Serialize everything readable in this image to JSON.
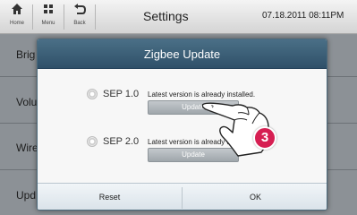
{
  "topbar": {
    "nav": [
      {
        "icon": "home-icon",
        "label": "Home"
      },
      {
        "icon": "menu-icon",
        "label": "Menu"
      },
      {
        "icon": "back-icon",
        "label": "Back"
      }
    ],
    "title": "Settings",
    "datetime": "07.18.2011 08:11PM"
  },
  "list": {
    "items": [
      "Brig",
      "Volu",
      "Wire",
      "Upd"
    ]
  },
  "dialog": {
    "title": "Zigbee Update",
    "options": [
      {
        "label": "SEP 1.0",
        "status": "Latest version is already installed.",
        "button": "Update"
      },
      {
        "label": "SEP 2.0",
        "status": "Latest version is already ins",
        "button": "Update"
      }
    ],
    "footer": {
      "reset": "Reset",
      "ok": "OK"
    }
  },
  "annotation": {
    "step": "3",
    "badge_color": "#d61f52"
  },
  "colors": {
    "dialog_header": "#3d6078",
    "update_button": "#b0b6bb"
  }
}
